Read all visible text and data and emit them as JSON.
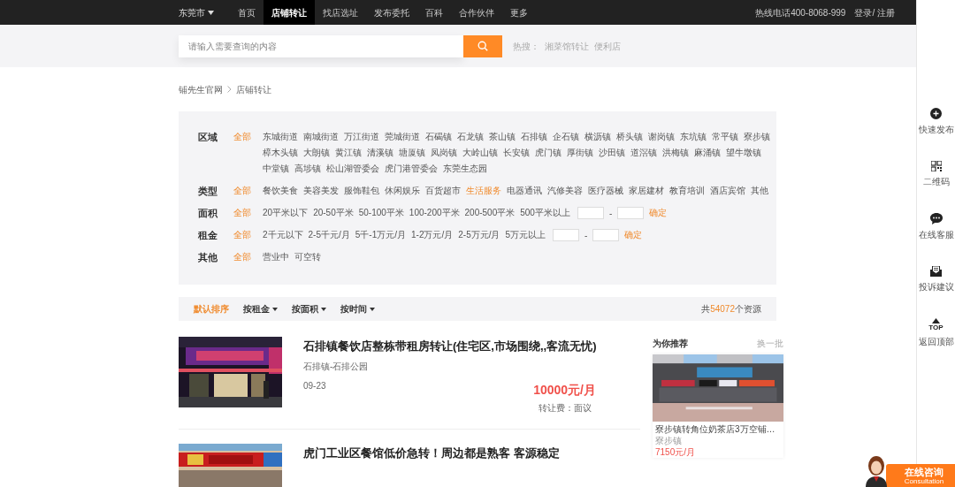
{
  "top_nav": {
    "city": "东莞市",
    "items": [
      {
        "label": "首页",
        "selected": false
      },
      {
        "label": "店铺转让",
        "selected": true
      },
      {
        "label": "找店选址",
        "selected": false
      },
      {
        "label": "发布委托",
        "selected": false
      },
      {
        "label": "百科",
        "selected": false
      },
      {
        "label": "合作伙伴",
        "selected": false
      },
      {
        "label": "更多",
        "selected": false
      }
    ],
    "hotline": "热线电话400-8068-999",
    "login": "登录/ 注册"
  },
  "search": {
    "placeholder": "请输入需要查询的内容",
    "hot_label": "热搜：",
    "hot_terms": [
      "湘菜馆转让",
      "便利店"
    ]
  },
  "breadcrumb": [
    "铺先生官网",
    "店铺转让"
  ],
  "filters": [
    {
      "label": "区域",
      "kind": "options",
      "options": [
        {
          "label": "全部",
          "selected": true
        },
        {
          "label": "东城街道",
          "selected": false
        },
        {
          "label": "南城街道",
          "selected": false
        },
        {
          "label": "万江街道",
          "selected": false
        },
        {
          "label": "莞城街道",
          "selected": false
        },
        {
          "label": "石碣镇",
          "selected": false
        },
        {
          "label": "石龙镇",
          "selected": false
        },
        {
          "label": "茶山镇",
          "selected": false
        },
        {
          "label": "石排镇",
          "selected": false
        },
        {
          "label": "企石镇",
          "selected": false
        },
        {
          "label": "横沥镇",
          "selected": false
        },
        {
          "label": "桥头镇",
          "selected": false
        },
        {
          "label": "谢岗镇",
          "selected": false
        },
        {
          "label": "东坑镇",
          "selected": false
        },
        {
          "label": "常平镇",
          "selected": false
        },
        {
          "label": "寮步镇",
          "selected": false
        },
        {
          "label": "樟木头镇",
          "selected": false
        },
        {
          "label": "大朗镇",
          "selected": false
        },
        {
          "label": "黄江镇",
          "selected": false
        },
        {
          "label": "清溪镇",
          "selected": false
        },
        {
          "label": "塘厦镇",
          "selected": false
        },
        {
          "label": "凤岗镇",
          "selected": false
        },
        {
          "label": "大岭山镇",
          "selected": false
        },
        {
          "label": "长安镇",
          "selected": false
        },
        {
          "label": "虎门镇",
          "selected": false
        },
        {
          "label": "厚街镇",
          "selected": false
        },
        {
          "label": "沙田镇",
          "selected": false
        },
        {
          "label": "道滘镇",
          "selected": false
        },
        {
          "label": "洪梅镇",
          "selected": false
        },
        {
          "label": "麻涌镇",
          "selected": false
        },
        {
          "label": "望牛墩镇",
          "selected": false
        },
        {
          "label": "中堂镇",
          "selected": false
        },
        {
          "label": "高埗镇",
          "selected": false
        },
        {
          "label": "松山湖管委会",
          "selected": false
        },
        {
          "label": "虎门港管委会",
          "selected": false
        },
        {
          "label": "东莞生态园",
          "selected": false
        }
      ]
    },
    {
      "label": "类型",
      "kind": "options",
      "options": [
        {
          "label": "全部",
          "selected": true
        },
        {
          "label": "餐饮美食",
          "selected": false
        },
        {
          "label": "美容美发",
          "selected": false
        },
        {
          "label": "服饰鞋包",
          "selected": false
        },
        {
          "label": "休闲娱乐",
          "selected": false
        },
        {
          "label": "百货超市",
          "selected": false
        },
        {
          "label": "生活服务",
          "selected": true
        },
        {
          "label": "电器通讯",
          "selected": false
        },
        {
          "label": "汽修美容",
          "selected": false
        },
        {
          "label": "医疗器械",
          "selected": false
        },
        {
          "label": "家居建材",
          "selected": false
        },
        {
          "label": "教育培训",
          "selected": false
        },
        {
          "label": "酒店宾馆",
          "selected": false
        },
        {
          "label": "其他",
          "selected": false
        }
      ]
    },
    {
      "label": "面积",
      "kind": "range",
      "options": [
        {
          "label": "全部",
          "selected": true
        },
        {
          "label": "20平米以下",
          "selected": false
        },
        {
          "label": "20-50平米",
          "selected": false
        },
        {
          "label": "50-100平米",
          "selected": false
        },
        {
          "label": "100-200平米",
          "selected": false
        },
        {
          "label": "200-500平米",
          "selected": false
        },
        {
          "label": "500平米以上",
          "selected": false
        }
      ],
      "separator": "-",
      "confirm": "确定"
    },
    {
      "label": "租金",
      "kind": "range",
      "options": [
        {
          "label": "全部",
          "selected": true
        },
        {
          "label": "2千元以下",
          "selected": false
        },
        {
          "label": "2-5千元/月",
          "selected": false
        },
        {
          "label": "5千-1万元/月",
          "selected": false
        },
        {
          "label": "1-2万元/月",
          "selected": false
        },
        {
          "label": "2-5万元/月",
          "selected": false
        },
        {
          "label": "5万元以上",
          "selected": false
        }
      ],
      "separator": "-",
      "confirm": "确定"
    },
    {
      "label": "其他",
      "kind": "options",
      "options": [
        {
          "label": "全部",
          "selected": true
        },
        {
          "label": "营业中",
          "selected": false
        },
        {
          "label": "可空转",
          "selected": false
        }
      ]
    }
  ],
  "sort": {
    "options": [
      {
        "label": "默认排序",
        "selected": true,
        "dropdown": false
      },
      {
        "label": "按租金",
        "selected": false,
        "dropdown": true
      },
      {
        "label": "按面积",
        "selected": false,
        "dropdown": true
      },
      {
        "label": "按时间",
        "selected": false,
        "dropdown": true
      }
    ],
    "total_prefix": "共",
    "total": "54072",
    "total_suffix": "个资源"
  },
  "listings": [
    {
      "title": "石排镇餐饮店整栋带租房转让(住宅区,市场围绕,,客流无忧)",
      "location": "石排镇-石排公园",
      "date": "09-23",
      "price": "10000元/月",
      "transfer_fee": "转让费：面议"
    },
    {
      "title": "虎门工业区餐馆低价急转！周边都是熟客 客源稳定"
    }
  ],
  "recommend": {
    "title": "为你推荐",
    "refresh": "换一批",
    "items": [
      {
        "title": "寮步镇转角位奶茶店3万空铺…",
        "location": "寮步镇",
        "price": "7150元/月"
      }
    ]
  },
  "side_tools": [
    {
      "kind": "publish",
      "label": "快速发布"
    },
    {
      "kind": "qrcode",
      "label": "二维码"
    },
    {
      "kind": "chat",
      "label": "在线客服"
    },
    {
      "kind": "complaint",
      "label": "投诉建议"
    },
    {
      "kind": "top",
      "label": "返回顶部",
      "icon_text": "TOP"
    }
  ],
  "consult": {
    "title": "在线咨询",
    "subtitle": "Consultation"
  }
}
